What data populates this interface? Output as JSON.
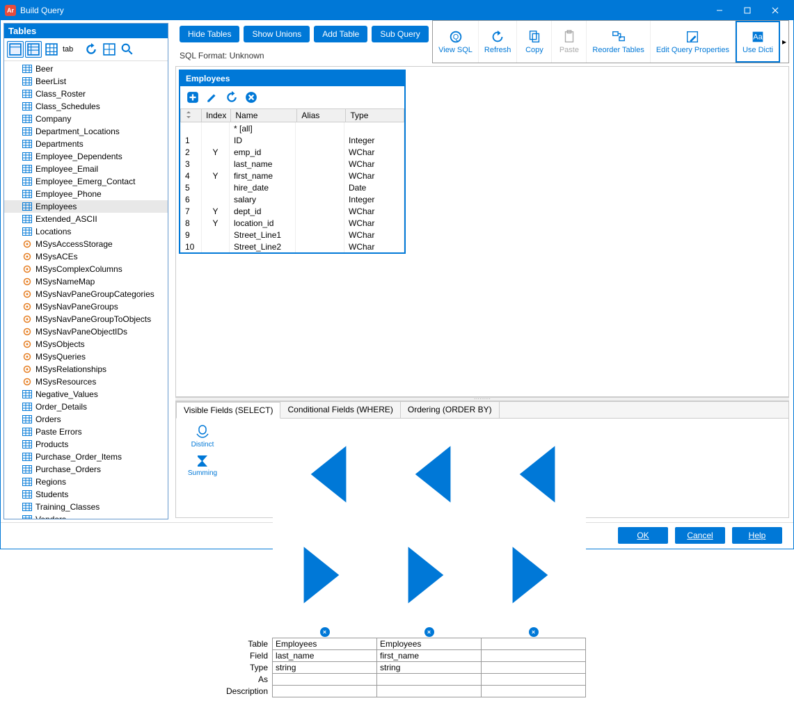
{
  "window": {
    "title": "Build Query"
  },
  "tables_panel": {
    "header": "Tables",
    "tab_label": "tab",
    "items": [
      {
        "name": "Beer",
        "icon": "blue"
      },
      {
        "name": "BeerList",
        "icon": "blue"
      },
      {
        "name": "Class_Roster",
        "icon": "blue"
      },
      {
        "name": "Class_Schedules",
        "icon": "blue"
      },
      {
        "name": "Company",
        "icon": "blue"
      },
      {
        "name": "Department_Locations",
        "icon": "blue"
      },
      {
        "name": "Departments",
        "icon": "blue"
      },
      {
        "name": "Employee_Dependents",
        "icon": "blue"
      },
      {
        "name": "Employee_Email",
        "icon": "blue"
      },
      {
        "name": "Employee_Emerg_Contact",
        "icon": "blue"
      },
      {
        "name": "Employee_Phone",
        "icon": "blue"
      },
      {
        "name": "Employees",
        "icon": "blue",
        "selected": true
      },
      {
        "name": "Extended_ASCII",
        "icon": "blue"
      },
      {
        "name": "Locations",
        "icon": "blue"
      },
      {
        "name": "MSysAccessStorage",
        "icon": "orange"
      },
      {
        "name": "MSysACEs",
        "icon": "orange"
      },
      {
        "name": "MSysComplexColumns",
        "icon": "orange"
      },
      {
        "name": "MSysNameMap",
        "icon": "orange"
      },
      {
        "name": "MSysNavPaneGroupCategories",
        "icon": "orange"
      },
      {
        "name": "MSysNavPaneGroups",
        "icon": "orange"
      },
      {
        "name": "MSysNavPaneGroupToObjects",
        "icon": "orange"
      },
      {
        "name": "MSysNavPaneObjectIDs",
        "icon": "orange"
      },
      {
        "name": "MSysObjects",
        "icon": "orange"
      },
      {
        "name": "MSysQueries",
        "icon": "orange"
      },
      {
        "name": "MSysRelationships",
        "icon": "orange"
      },
      {
        "name": "MSysResources",
        "icon": "orange"
      },
      {
        "name": "Negative_Values",
        "icon": "blue"
      },
      {
        "name": "Order_Details",
        "icon": "blue"
      },
      {
        "name": "Orders",
        "icon": "blue"
      },
      {
        "name": "Paste Errors",
        "icon": "blue"
      },
      {
        "name": "Products",
        "icon": "blue"
      },
      {
        "name": "Purchase_Order_Items",
        "icon": "blue"
      },
      {
        "name": "Purchase_Orders",
        "icon": "blue"
      },
      {
        "name": "Regions",
        "icon": "blue"
      },
      {
        "name": "Students",
        "icon": "blue"
      },
      {
        "name": "Training_Classes",
        "icon": "blue"
      },
      {
        "name": "Vendors",
        "icon": "blue"
      }
    ]
  },
  "toolbar": {
    "hide_tables": "Hide Tables",
    "show_unions": "Show Unions",
    "add_table": "Add Table",
    "sub_query": "Sub Query"
  },
  "ribbon": {
    "view_sql": "View SQL",
    "refresh": "Refresh",
    "copy": "Copy",
    "paste": "Paste",
    "reorder": "Reorder Tables",
    "edit_props": "Edit Query Properties",
    "use_dict": "Use Dicti"
  },
  "sql_format": "SQL Format: Unknown",
  "employees_box": {
    "title": "Employees",
    "columns": {
      "c0": "",
      "c1": "Index",
      "c2": "Name",
      "c3": "Alias",
      "c4": "Type"
    },
    "rows": [
      {
        "n": "",
        "idx": "",
        "name": "* [all]",
        "alias": "",
        "type": ""
      },
      {
        "n": "1",
        "idx": "",
        "name": "ID",
        "alias": "",
        "type": "Integer"
      },
      {
        "n": "2",
        "idx": "Y",
        "name": "emp_id",
        "alias": "",
        "type": "WChar"
      },
      {
        "n": "3",
        "idx": "",
        "name": "last_name",
        "alias": "",
        "type": "WChar"
      },
      {
        "n": "4",
        "idx": "Y",
        "name": "first_name",
        "alias": "",
        "type": "WChar",
        "selected": true
      },
      {
        "n": "5",
        "idx": "",
        "name": "hire_date",
        "alias": "",
        "type": "Date"
      },
      {
        "n": "6",
        "idx": "",
        "name": "salary",
        "alias": "",
        "type": "Integer"
      },
      {
        "n": "7",
        "idx": "Y",
        "name": "dept_id",
        "alias": "",
        "type": "WChar"
      },
      {
        "n": "8",
        "idx": "Y",
        "name": "location_id",
        "alias": "",
        "type": "WChar"
      },
      {
        "n": "9",
        "idx": "",
        "name": "Street_Line1",
        "alias": "",
        "type": "WChar"
      },
      {
        "n": "10",
        "idx": "",
        "name": "Street_Line2",
        "alias": "",
        "type": "WChar"
      }
    ]
  },
  "tabs": {
    "visible": "Visible Fields (SELECT)",
    "conditional": "Conditional Fields (WHERE)",
    "ordering": "Ordering (ORDER BY)"
  },
  "fields_left": {
    "distinct": "Distinct",
    "summing": "Summing"
  },
  "fields_grid": {
    "labels": {
      "table": "Table",
      "field": "Field",
      "type": "Type",
      "as": "As",
      "desc": "Description"
    },
    "cols": [
      {
        "table": "Employees",
        "field": "last_name",
        "type": "string",
        "as": "",
        "desc": ""
      },
      {
        "table": "Employees",
        "field": "first_name",
        "type": "string",
        "as": "",
        "desc": ""
      },
      {
        "table": "",
        "field": "",
        "type": "",
        "as": "",
        "desc": ""
      }
    ]
  },
  "footer": {
    "ok": "OK",
    "cancel": "Cancel",
    "help": "Help"
  }
}
